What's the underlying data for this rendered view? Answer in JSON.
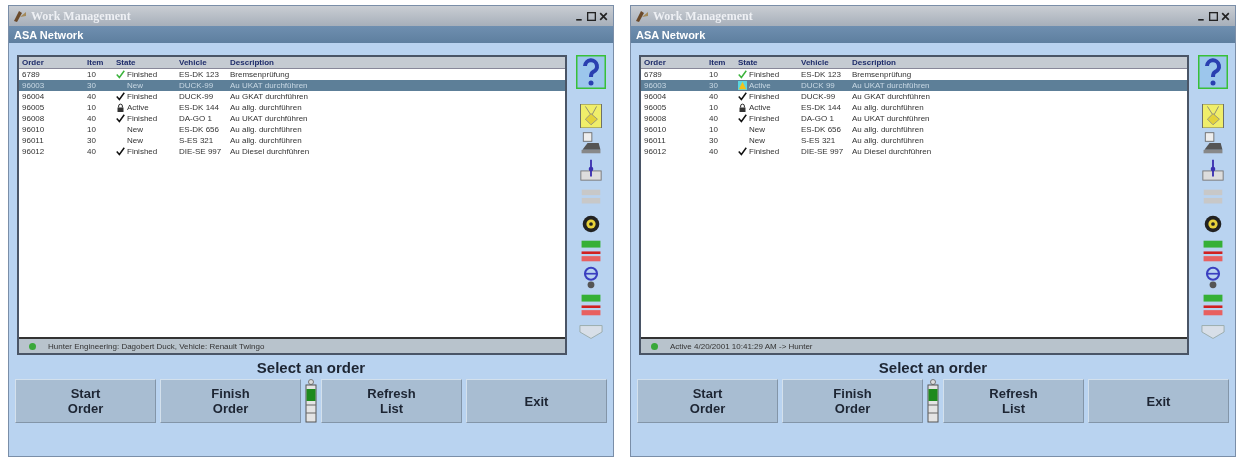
{
  "windows": [
    {
      "title": "Work Management",
      "subtitle": "ASA Network",
      "columns": [
        "Order",
        "Item",
        "State",
        "Vehicle",
        "Description"
      ],
      "rows": [
        {
          "order": "6789",
          "item": "10",
          "state": "Finished",
          "kind": "finished-green",
          "vehicle": "ES-DK 123",
          "description": "Bremsenprüfung",
          "selected": false
        },
        {
          "order": "96003",
          "item": "30",
          "state": "New",
          "kind": "new",
          "vehicle": "DUCK-99",
          "description": "Au UKAT durchführen",
          "selected": true
        },
        {
          "order": "96004",
          "item": "40",
          "state": "Finished",
          "kind": "finished",
          "vehicle": "DUCK-99",
          "description": "Au GKAT durchführen",
          "selected": false
        },
        {
          "order": "96005",
          "item": "10",
          "state": "Active",
          "kind": "active",
          "vehicle": "ES-DK 144",
          "description": "Au allg. durchführen",
          "selected": false
        },
        {
          "order": "96008",
          "item": "40",
          "state": "Finished",
          "kind": "finished",
          "vehicle": "DA-GO 1",
          "description": "Au UKAT durchführen",
          "selected": false
        },
        {
          "order": "96010",
          "item": "10",
          "state": "New",
          "kind": "new",
          "vehicle": "ES-DK 656",
          "description": "Au allg. durchführen",
          "selected": false
        },
        {
          "order": "96011",
          "item": "30",
          "state": "New",
          "kind": "new",
          "vehicle": "S-ES 321",
          "description": "Au allg. durchführen",
          "selected": false
        },
        {
          "order": "96012",
          "item": "40",
          "state": "Finished",
          "kind": "finished",
          "vehicle": "DIE-SE 997",
          "description": "Au Diesel durchführen",
          "selected": false
        }
      ],
      "status": "Hunter Engineering: Dagobert Duck, Vehicle: Renault Twingo",
      "prompt": "Select an order",
      "buttons": [
        [
          "Start",
          "Order"
        ],
        [
          "Finish",
          "Order"
        ],
        [
          "Refresh",
          "List"
        ],
        [
          "Exit"
        ]
      ]
    },
    {
      "title": "Work Management",
      "subtitle": "ASA Network",
      "columns": [
        "Order",
        "Item",
        "State",
        "Vehicle",
        "Description"
      ],
      "rows": [
        {
          "order": "6789",
          "item": "10",
          "state": "Finished",
          "kind": "finished-green",
          "vehicle": "ES-DK 123",
          "description": "Bremsenprüfung",
          "selected": false
        },
        {
          "order": "96003",
          "item": "30",
          "state": "Active",
          "kind": "warning",
          "vehicle": "DUCK 99",
          "description": "Au UKAT durchführen",
          "selected": true
        },
        {
          "order": "96004",
          "item": "40",
          "state": "Finished",
          "kind": "finished",
          "vehicle": "DUCK-99",
          "description": "Au GKAT durchführen",
          "selected": false
        },
        {
          "order": "96005",
          "item": "10",
          "state": "Active",
          "kind": "active",
          "vehicle": "ES-DK 144",
          "description": "Au allg. durchführen",
          "selected": false
        },
        {
          "order": "96008",
          "item": "40",
          "state": "Finished",
          "kind": "finished",
          "vehicle": "DA-GO 1",
          "description": "Au UKAT durchführen",
          "selected": false
        },
        {
          "order": "96010",
          "item": "10",
          "state": "New",
          "kind": "new",
          "vehicle": "ES-DK 656",
          "description": "Au allg. durchführen",
          "selected": false
        },
        {
          "order": "96011",
          "item": "30",
          "state": "New",
          "kind": "new",
          "vehicle": "S-ES 321",
          "description": "Au allg. durchführen",
          "selected": false
        },
        {
          "order": "96012",
          "item": "40",
          "state": "Finished",
          "kind": "finished",
          "vehicle": "DIE-SE 997",
          "description": "Au Diesel durchführen",
          "selected": false
        }
      ],
      "status": "Active 4/20/2001 10:41:29 AM -> Hunter",
      "prompt": "Select an order",
      "buttons": [
        [
          "Start",
          "Order"
        ],
        [
          "Finish",
          "Order"
        ],
        [
          "Refresh",
          "List"
        ],
        [
          "Exit"
        ]
      ]
    }
  ]
}
